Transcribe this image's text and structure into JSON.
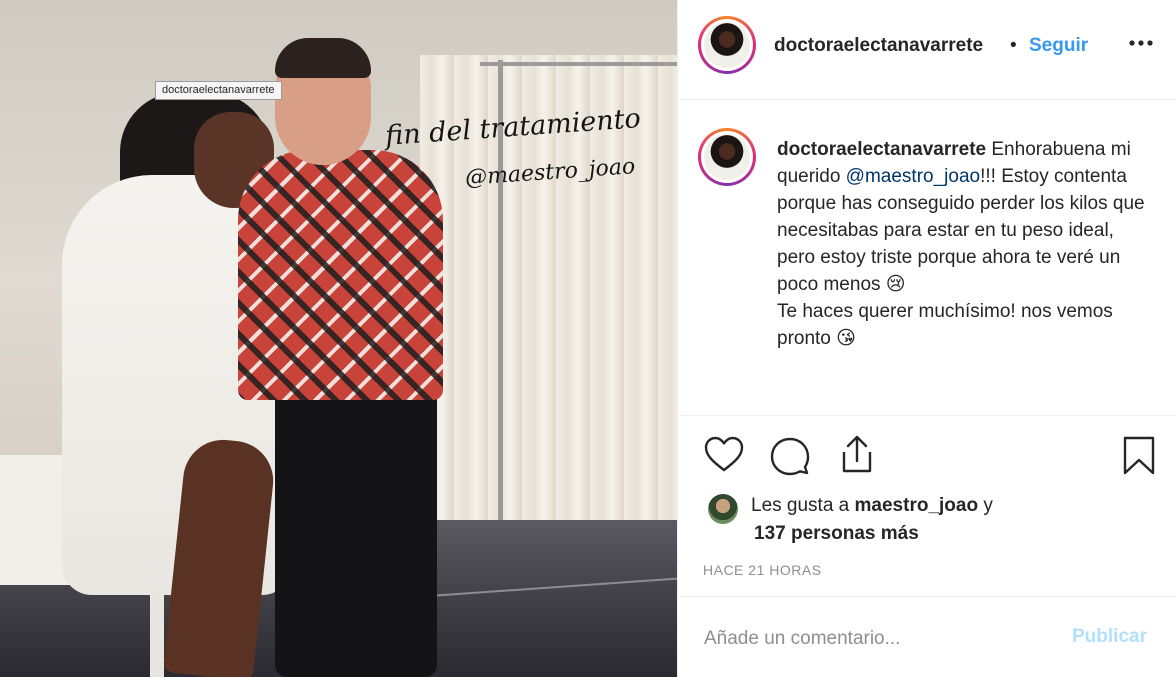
{
  "post": {
    "image": {
      "overlay_line1": "fin del tratamiento",
      "overlay_line2": "@maestro_joao",
      "tag_label": "doctoraelectanavarrete"
    },
    "header": {
      "username": "doctoraelectanavarrete",
      "separator": "•",
      "follow_label": "Seguir",
      "more_icon": "more-horizontal-icon"
    },
    "caption": {
      "username": "doctoraelectanavarrete",
      "part1": " Enhorabuena mi querido ",
      "mention": "@maestro_joao",
      "part2": "!!! Estoy contenta porque has conseguido perder los kilos que necesitabas para estar en tu peso ideal, pero estoy triste porque ahora te veré un poco menos 😢",
      "part3": "Te haces querer muchísimo! nos vemos pronto 😘"
    },
    "actions": {
      "icons": [
        "heart-icon",
        "comment-icon",
        "share-icon",
        "bookmark-icon"
      ]
    },
    "likes": {
      "prefix": "Les gusta a ",
      "user": "maestro_joao",
      "suffix": " y",
      "others": "137 personas más"
    },
    "timestamp": "HACE 21 HORAS",
    "comment_box": {
      "placeholder": "Añade un comentario...",
      "publish_label": "Publicar",
      "publish_color": "#b2dffc"
    },
    "colors": {
      "follow": "#3897f0",
      "mention": "#003569",
      "muted": "#8e8e8e"
    }
  }
}
